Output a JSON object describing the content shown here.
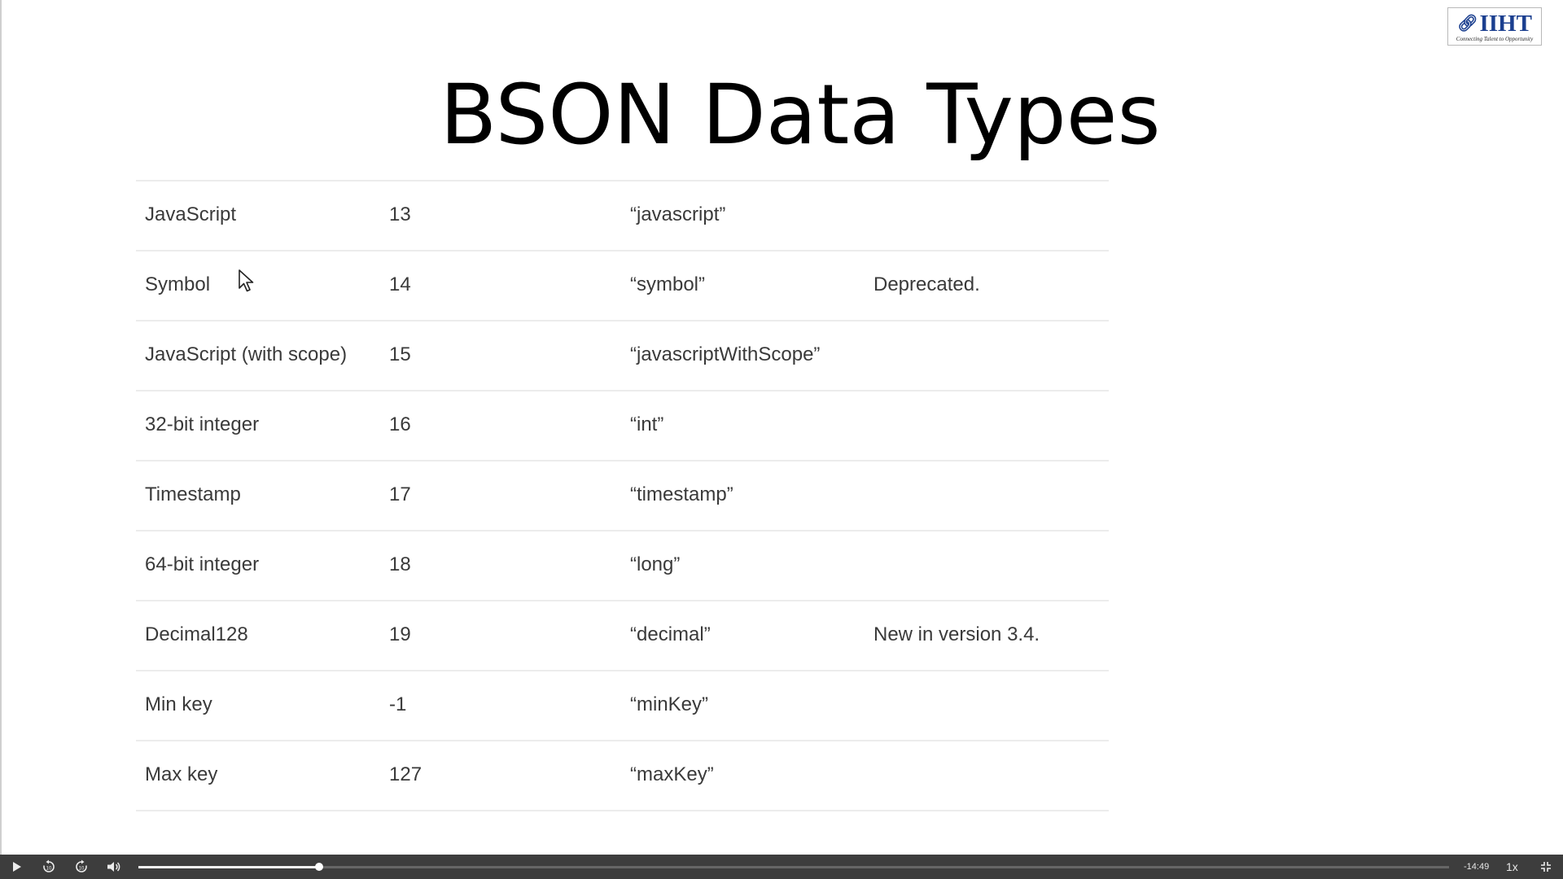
{
  "logo": {
    "text": "IIHT",
    "tagline": "Connecting Talent to Opportunity",
    "icon": "chain-link-icon",
    "color": "#1b3f8f"
  },
  "slide": {
    "title": "BSON Data Types",
    "rows": [
      {
        "type": "JavaScript",
        "number": "13",
        "alias": "“javascript”",
        "notes": ""
      },
      {
        "type": "Symbol",
        "number": "14",
        "alias": "“symbol”",
        "notes": "Deprecated."
      },
      {
        "type": "JavaScript (with scope)",
        "number": "15",
        "alias": "“javascriptWithScope”",
        "notes": ""
      },
      {
        "type": "32-bit integer",
        "number": "16",
        "alias": "“int”",
        "notes": ""
      },
      {
        "type": "Timestamp",
        "number": "17",
        "alias": "“timestamp”",
        "notes": ""
      },
      {
        "type": "64-bit integer",
        "number": "18",
        "alias": "“long”",
        "notes": ""
      },
      {
        "type": "Decimal128",
        "number": "19",
        "alias": "“decimal”",
        "notes": "New in version 3.4."
      },
      {
        "type": "Min key",
        "number": "-1",
        "alias": "“minKey”",
        "notes": ""
      },
      {
        "type": "Max key",
        "number": "127",
        "alias": "“maxKey”",
        "notes": ""
      }
    ]
  },
  "player": {
    "play_icon": "play-icon",
    "rewind_icon": "rewind-10-icon",
    "forward_icon": "forward-10-icon",
    "volume_icon": "volume-icon",
    "fullscreen_icon": "exit-fullscreen-icon",
    "progress_fraction": 0.138,
    "time_remaining": "-14:49",
    "speed": "1x"
  }
}
